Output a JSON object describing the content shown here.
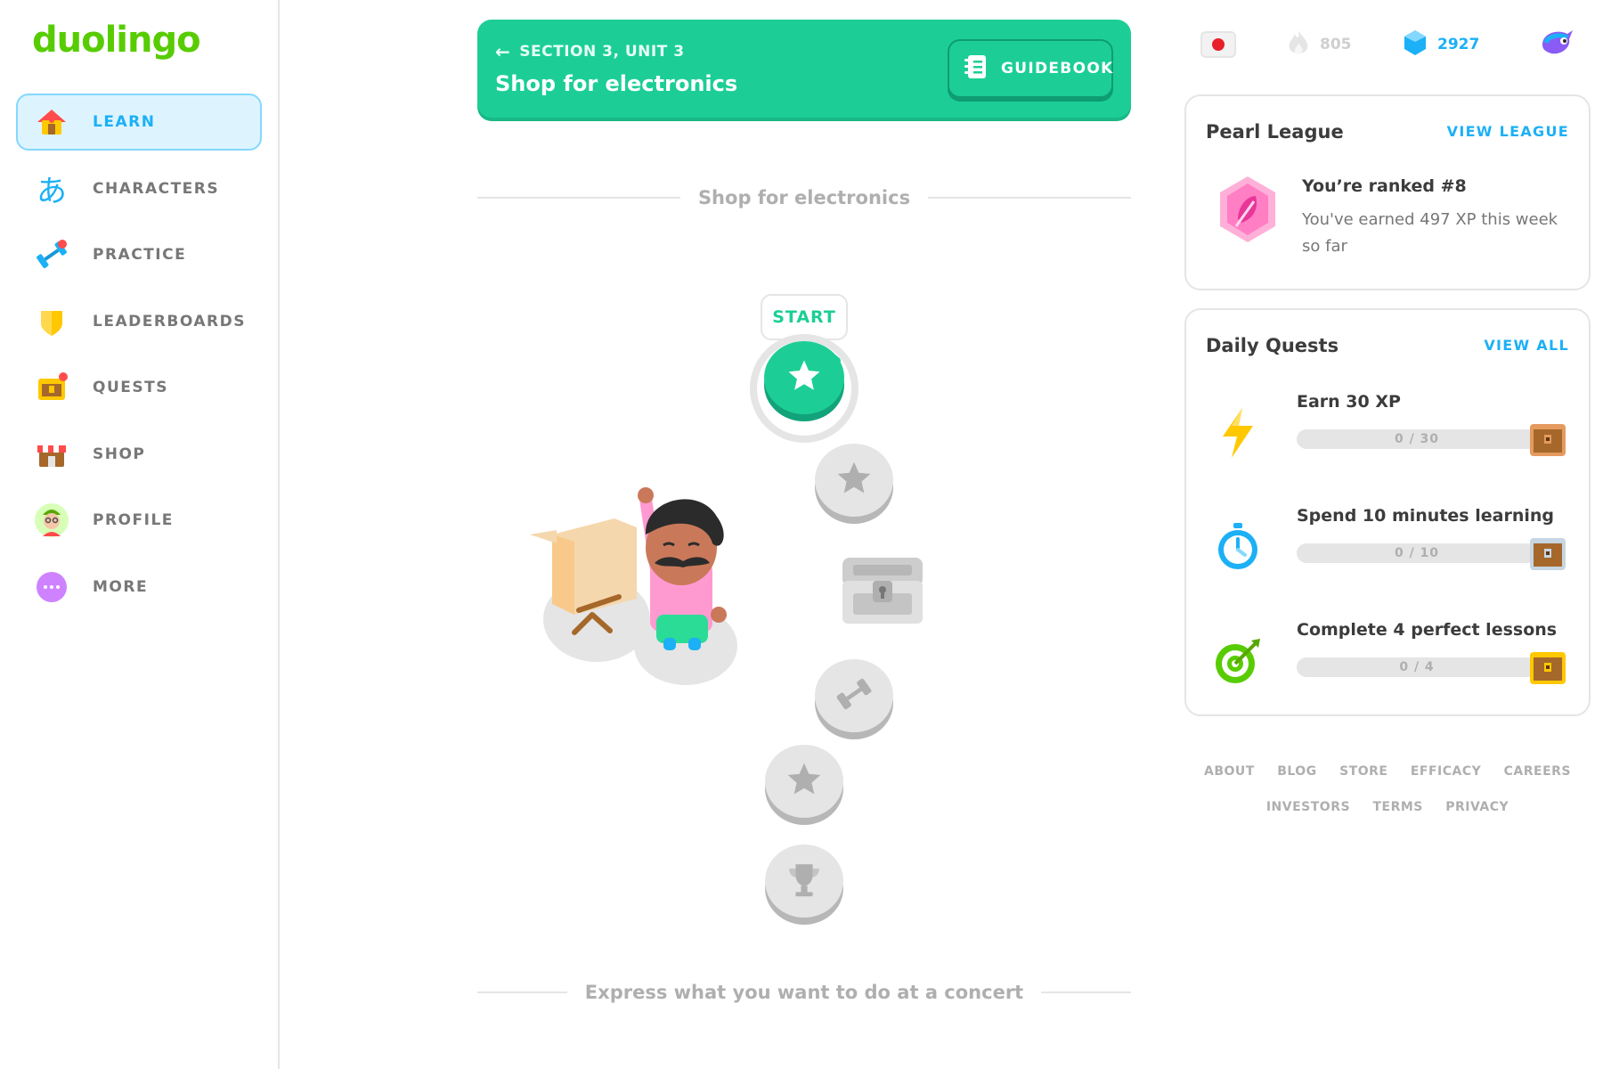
{
  "brand": {
    "logo_text": "duolingo",
    "color": "#58cc02"
  },
  "sidebar": {
    "items": [
      {
        "label": "LEARN",
        "icon": "home-icon",
        "active": true
      },
      {
        "label": "CHARACTERS",
        "icon": "hiragana-a-icon"
      },
      {
        "label": "PRACTICE",
        "icon": "dumbbell-icon"
      },
      {
        "label": "LEADERBOARDS",
        "icon": "shield-icon"
      },
      {
        "label": "QUESTS",
        "icon": "treasure-chest-icon"
      },
      {
        "label": "SHOP",
        "icon": "shop-icon"
      },
      {
        "label": "PROFILE",
        "icon": "avatar-icon"
      },
      {
        "label": "MORE",
        "icon": "more-dots-icon"
      }
    ]
  },
  "unit": {
    "section_label": "SECTION 3, UNIT 3",
    "title": "Shop for electronics",
    "guidebook_label": "GUIDEBOOK",
    "color": "#1cce96"
  },
  "path": {
    "divider_top": "Shop for electronics",
    "start_label": "START",
    "divider_bottom": "Express what you want to do at a concert",
    "nodes": [
      "start-star",
      "locked-star",
      "locked-chest",
      "locked-practice",
      "locked-star",
      "locked-trophy"
    ]
  },
  "stats": {
    "language_flag": "japanese-flag-icon",
    "streak": "805",
    "gems": "2927",
    "gem_color": "#1cb0f6"
  },
  "league": {
    "title": "Pearl League",
    "link": "VIEW LEAGUE",
    "rank_text": "You’re ranked #8",
    "xp_line1": "You've earned 497 XP this week",
    "xp_line2": "so far"
  },
  "quests": {
    "title": "Daily Quests",
    "link": "VIEW ALL",
    "items": [
      {
        "name": "Earn 30 XP",
        "progress": "0 / 30",
        "current": 0,
        "goal": 30,
        "icon": "lightning-icon"
      },
      {
        "name": "Spend 10 minutes learning",
        "progress": "0 / 10",
        "current": 0,
        "goal": 10,
        "icon": "stopwatch-icon"
      },
      {
        "name": "Complete 4 perfect lessons",
        "progress": "0 / 4",
        "current": 0,
        "goal": 4,
        "icon": "target-icon"
      }
    ]
  },
  "footer": {
    "row1": [
      "ABOUT",
      "BLOG",
      "STORE",
      "EFFICACY",
      "CAREERS"
    ],
    "row2": [
      "INVESTORS",
      "TERMS",
      "PRIVACY"
    ]
  }
}
